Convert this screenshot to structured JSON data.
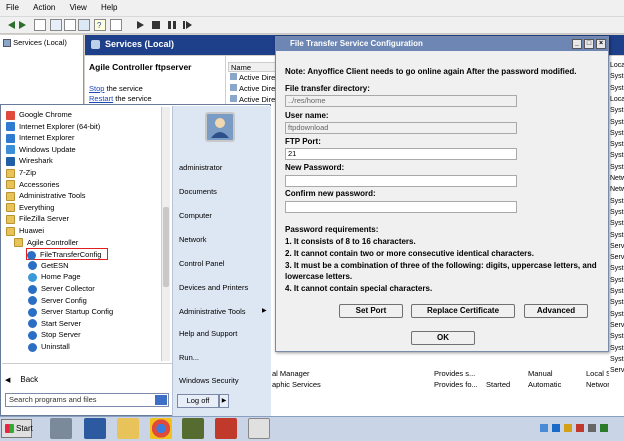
{
  "menubar": {
    "items": [
      "File",
      "Action",
      "View",
      "Help"
    ]
  },
  "tree": {
    "root_label": "Services (Local)"
  },
  "services": {
    "header": "Services (Local)",
    "selected_name": "Agile Controller ftpserver",
    "stop_link": "Stop",
    "stop_suffix": " the service",
    "restart_link": "Restart",
    "restart_suffix": " the service",
    "col_name": "Name",
    "rows_top": [
      "Active Dire",
      "Active Dire",
      "Active Dire"
    ],
    "bottom_rows": [
      {
        "name": "al Manager",
        "desc": "Provides s...",
        "status": "",
        "startup": "Manual",
        "logon": "Local Syster"
      },
      {
        "name": "aphic Services",
        "desc": "Provides fo...",
        "status": "Started",
        "startup": "Automatic",
        "logon": "Network S..."
      }
    ],
    "right_col": [
      "Local",
      "Syste",
      "Syste",
      "Local",
      "Syste",
      "Syste",
      "Syste",
      "Syste",
      "Syste",
      "Syste",
      "NetwU",
      "NetwU",
      "Syste",
      "Syste",
      "Syste",
      "Syste",
      "Servi",
      "Servi",
      "Syste",
      "Syste",
      "Syste",
      "Syste",
      "Syste",
      "Servi",
      "Syste",
      "Syste",
      "Syste",
      "Servi"
    ]
  },
  "start_menu": {
    "items": [
      {
        "label": "Google Chrome",
        "color": "#e04a3a"
      },
      {
        "label": "Internet Explorer (64-bit)",
        "color": "#2f7bd2"
      },
      {
        "label": "Internet Explorer",
        "color": "#2f7bd2"
      },
      {
        "label": "Windows Update",
        "color": "#3a8fd8"
      },
      {
        "label": "Wireshark",
        "color": "#1f5fa8"
      },
      {
        "label": "7-Zip",
        "color": "folder"
      },
      {
        "label": "Accessories",
        "color": "folder"
      },
      {
        "label": "Administrative Tools",
        "color": "folder"
      },
      {
        "label": "Everything",
        "color": "folder"
      },
      {
        "label": "FileZilla Server",
        "color": "folder"
      },
      {
        "label": "Huawei",
        "color": "folder"
      }
    ],
    "agile_folder": "Agile Controller",
    "sub_items": [
      "FileTransferConfig",
      "GetESN",
      "Home Page",
      "Server Collector",
      "Server Config",
      "Server Startup Config",
      "Start Server",
      "Stop Server",
      "Uninstall"
    ],
    "back_label": "Back",
    "search_placeholder": "Search programs and files",
    "right_items": [
      "administrator",
      "Documents",
      "Computer",
      "Network",
      "Control Panel",
      "Devices and Printers",
      "Administrative Tools",
      "Help and Support",
      "Run...",
      "Windows Security"
    ],
    "logoff_label": "Log off"
  },
  "dialog": {
    "title": "File Transfer Service Configuration",
    "note": "Note: Anyoffice Client needs to go online again After the password modified.",
    "dir_label": "File transfer directory:",
    "dir_value": "../res/home",
    "user_label": "User name:",
    "user_value": "ftpdownload",
    "port_label": "FTP Port:",
    "port_value": "21",
    "newpw_label": "New Password:",
    "confirmpw_label": "Confirm new password:",
    "req_title": "Password requirements:",
    "req_1": "1. It consists of 8 to 16 characters.",
    "req_2": "2. It cannot contain two or more consecutive identical characters.",
    "req_3a": "3. It must be a combination of three of the following: digits, uppercase letters, and",
    "req_3b": "lowercase letters.",
    "req_4": "4. It cannot contain special characters.",
    "btn_set_port": "Set Port",
    "btn_replace_cert": "Replace Certificate",
    "btn_advanced": "Advanced",
    "btn_ok": "OK"
  },
  "taskbar": {
    "start_label": "Start"
  }
}
